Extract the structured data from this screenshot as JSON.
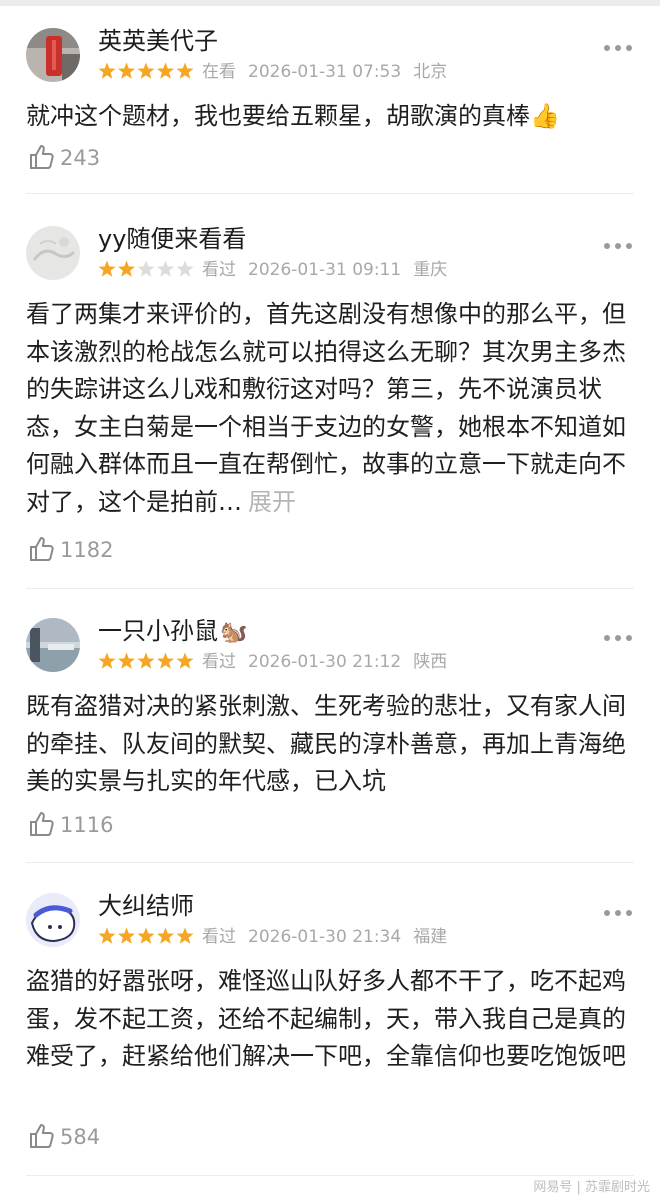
{
  "reviews": [
    {
      "user": "英英美代子",
      "name_emoji": "",
      "rating": 5,
      "status": "在看",
      "datetime": "2026-01-31 07:53",
      "location": "北京",
      "content": "就冲这个题材，我也要给五颗星，胡歌演的真棒👍",
      "expand_label": "",
      "likes": "243"
    },
    {
      "user": "yy随便来看看",
      "name_emoji": "",
      "rating": 2,
      "status": "看过",
      "datetime": "2026-01-31 09:11",
      "location": "重庆",
      "content": "看了两集才来评价的，首先这剧没有想像中的那么平，但本该激烈的枪战怎么就可以拍得这么无聊？其次男主多杰的失踪讲这么儿戏和敷衍这对吗？第三，先不说演员状态，女主白菊是一个相当于支边的女警，她根本不知道如何融入群体而且一直在帮倒忙，故事的立意一下就走向不对了，这个是拍前…",
      "expand_label": "展开",
      "likes": "1182"
    },
    {
      "user": "一只小孙鼠",
      "name_emoji": "🐿️",
      "rating": 5,
      "status": "看过",
      "datetime": "2026-01-30 21:12",
      "location": "陕西",
      "content": "既有盗猎对决的紧张刺激、生死考验的悲壮，又有家人间的牵挂、队友间的默契、藏民的淳朴善意，再加上青海绝美的实景与扎实的年代感，已入坑",
      "expand_label": "",
      "likes": "1116"
    },
    {
      "user": "大纠结师",
      "name_emoji": "",
      "rating": 5,
      "status": "看过",
      "datetime": "2026-01-30 21:34",
      "location": "福建",
      "content": "盗猎的好嚣张呀，难怪巡山队好多人都不干了，吃不起鸡蛋，发不起工资，还给不起编制，天，带入我自己是真的难受了，赶紧给他们解决一下吧，全靠信仰也要吃饱饭吧",
      "expand_label": "",
      "likes": "584"
    }
  ],
  "colors": {
    "star_on": "#f5a623",
    "star_off": "#dcdcdc",
    "meta": "#a8a8a8",
    "expand": "#b5b5b5"
  },
  "watermark": "网易号 | 苏霏剧时光"
}
